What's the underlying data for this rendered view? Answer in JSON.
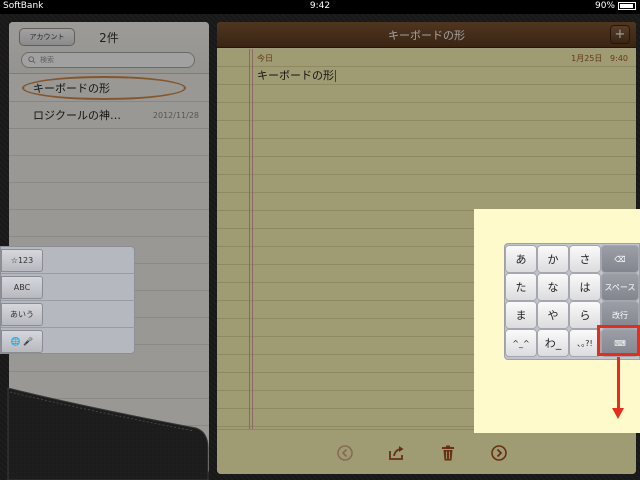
{
  "status": {
    "carrier": "SoftBank",
    "time": "9:42",
    "battery": "90%",
    "battery_level": 0.9
  },
  "left": {
    "account_btn": "アカウント",
    "count": "2件",
    "search_placeholder": "検索",
    "notes": [
      {
        "title": "キーボードの形",
        "date": ""
      },
      {
        "title": "ロジクールの神…",
        "date": "2012/11/28"
      }
    ]
  },
  "note": {
    "title": "キーボードの形",
    "today": "今日",
    "date": "1月25日",
    "time": "9:40",
    "body": "キーボードの形"
  },
  "toolbar": {
    "prev_icon": "arrow-left-circle-icon",
    "share_icon": "share-icon",
    "trash_icon": "trash-icon",
    "next_icon": "arrow-right-circle-icon"
  },
  "leftkeyboard": {
    "keys": [
      "☆123",
      "ABC",
      "あいう",
      "🌐  🎤"
    ]
  },
  "rightkeyboard": {
    "keys": [
      "あ",
      "か",
      "さ",
      "た",
      "な",
      "は",
      "ま",
      "や",
      "ら",
      "^_^",
      "わ_",
      "､｡?!"
    ],
    "func": [
      "⌫",
      "スペース",
      "改行",
      "⌨"
    ]
  },
  "annotation_color": "#e32d1d",
  "accent_color": "#a34c1d"
}
